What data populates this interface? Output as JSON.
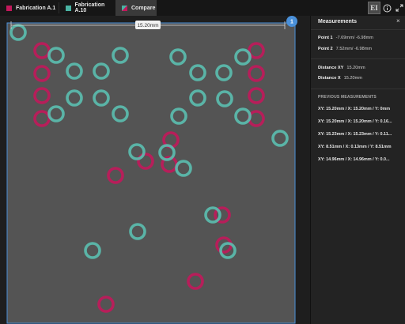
{
  "tabs": [
    {
      "label": "Fabrication A.1",
      "color": "#c2185b",
      "active": false
    },
    {
      "label": "Fabrication A.10",
      "color": "#4ab3a3",
      "active": false
    },
    {
      "label": "Compare",
      "active": true
    }
  ],
  "toolbar": {
    "ei_label": "EI",
    "info_glyph": "i"
  },
  "canvas": {
    "ruler_label": "15.20mm",
    "marker_label": "1",
    "colors": {
      "background": "#545454",
      "pink": "#c2185b",
      "teal": "#5bbfb0",
      "selection": "#4a90d9"
    }
  },
  "panel": {
    "title": "Measurements",
    "close_glyph": "×",
    "points": [
      {
        "key": "Point 1",
        "value": "-7.69mm/ -6.98mm"
      },
      {
        "key": "Point 2",
        "value": "7.52mm/ -6.98mm"
      }
    ],
    "distances": [
      {
        "key": "Distance XY",
        "value": "15.20mm"
      },
      {
        "key": "Distance X",
        "value": "15.20mm"
      }
    ],
    "previous_title": "PREVIOUS MEASUREMENTS",
    "previous": [
      "XY: 15.20mm / X: 15.20mm / Y: 0mm",
      "XY: 15.20mm / X: 15.20mm / Y: 0.16...",
      "XY: 15.23mm / X: 15.23mm / Y: 0.11...",
      "XY: 8.51mm / X: 0.13mm / Y: 8.51mm",
      "XY: 14.96mm / X: 14.96mm / Y: 0.0..."
    ]
  }
}
